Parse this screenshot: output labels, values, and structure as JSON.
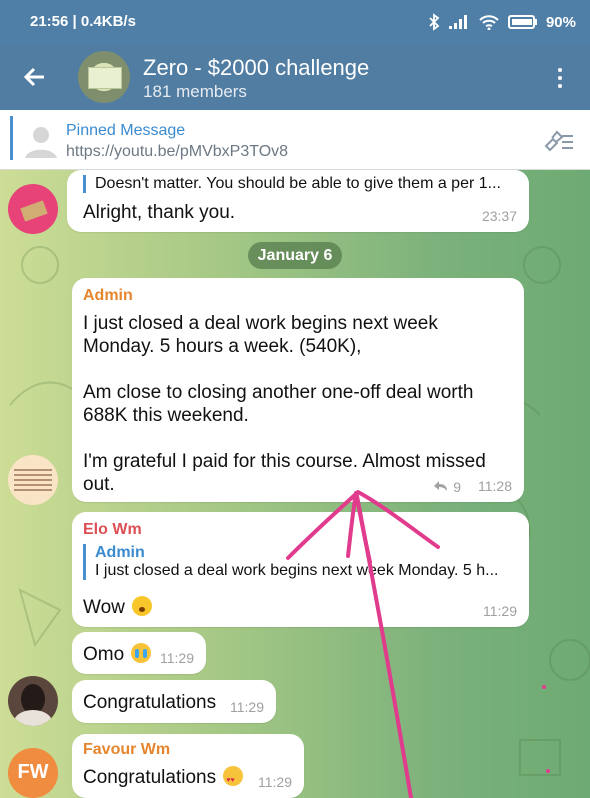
{
  "status_bar": {
    "left": "21:56 | 0.4KB/s",
    "battery": "90%"
  },
  "chat_header": {
    "title": "Zero - $2000 challenge",
    "members": "181 members"
  },
  "pinned": {
    "label": "Pinned Message",
    "link": "https://youtu.be/pMVbxP3TOv8"
  },
  "date_chip": "January 6",
  "messages": [
    {
      "reply_text": "Doesn't matter. You should be able to give them a per 1...",
      "text": "Alright, thank you.",
      "time": "23:37"
    },
    {
      "sender": "Admin",
      "text": "I just closed a deal work begins next week\nMonday. 5 hours a week. (540K),\n\nAm close to closing another one-off deal worth\n688K this weekend.\n\nI'm grateful I paid for this course. Almost missed\nout.",
      "shares": "9",
      "time": "11:28"
    },
    {
      "sender": "Elo Wm",
      "reply_name": "Admin",
      "reply_text": "I just closed a deal work begins next week Monday. 5 h...",
      "text": "Wow",
      "time": "11:29"
    },
    {
      "text": "Omo",
      "time": "11:29"
    },
    {
      "text": "Congratulations",
      "time": "11:29"
    },
    {
      "sender": "Favour Wm",
      "text": "Congratulations",
      "time": "11:29",
      "avatar_initials": "FW"
    }
  ],
  "colors": {
    "header": "#527da3",
    "accent_blue": "#3a8bcf",
    "admin_name": "#e5862f",
    "elo_name": "#dc4f55",
    "annotation": "#e13b8d"
  }
}
